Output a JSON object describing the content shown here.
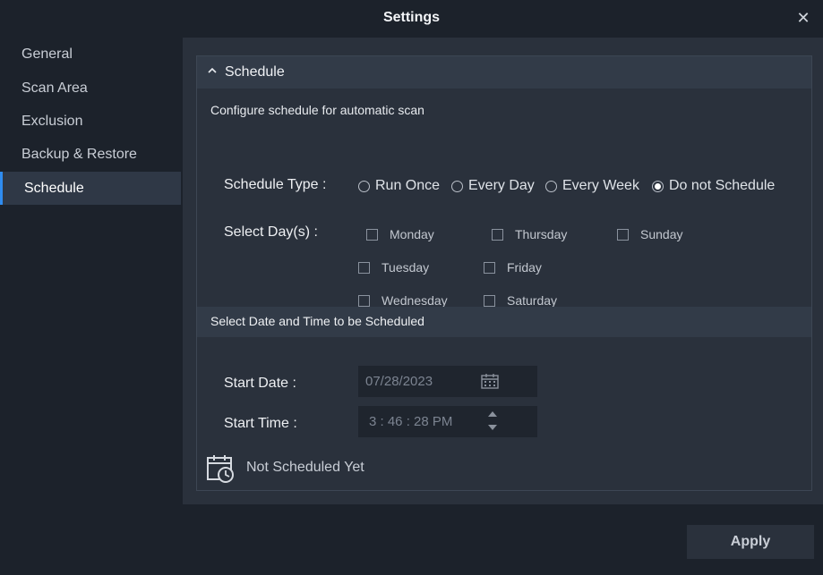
{
  "window": {
    "title": "Settings",
    "close_glyph": "✕"
  },
  "sidebar": {
    "items": [
      {
        "label": "General"
      },
      {
        "label": "Scan Area"
      },
      {
        "label": "Exclusion"
      },
      {
        "label": "Backup & Restore"
      },
      {
        "label": "Schedule",
        "active": true
      }
    ]
  },
  "panel": {
    "title": "Schedule",
    "subtitle": "Configure schedule for automatic scan",
    "schedule_type": {
      "label": "Schedule Type :",
      "options": [
        "Run Once",
        "Every Day",
        "Every Week",
        "Do not Schedule"
      ],
      "selected": "Do not Schedule"
    },
    "select_days": {
      "label": "Select Day(s) :",
      "days": [
        "Monday",
        "Thursday",
        "Sunday",
        "Tuesday",
        "Friday",
        "Wednesday",
        "Saturday"
      ]
    },
    "datetime_section": {
      "title": "Select Date and Time to be Scheduled",
      "start_date_label": "Start Date :",
      "start_date_value": "07/28/2023",
      "start_time_label": "Start Time :",
      "start_time_value": "3  : 46 : 28  PM"
    },
    "status": "Not Scheduled Yet"
  },
  "footer": {
    "apply_label": "Apply"
  },
  "colors": {
    "accent": "#2f8cf0",
    "background": "#1c222b",
    "panel": "#2a313c"
  }
}
